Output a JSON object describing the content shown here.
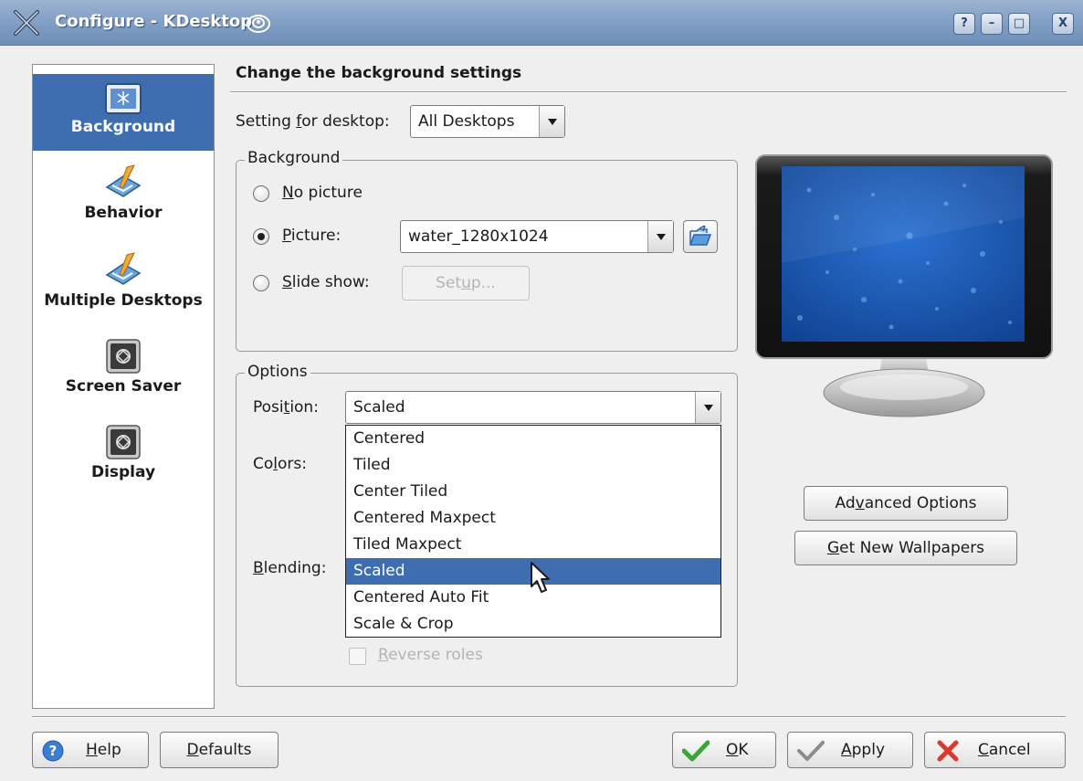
{
  "window": {
    "title": "Configure - KDesktop",
    "controls": {
      "help": "?",
      "minimize": "–",
      "maximize": "□",
      "close": "X"
    }
  },
  "sidebar": {
    "items": [
      {
        "label": "Background",
        "icon": "background-icon",
        "selected": true
      },
      {
        "label": "Behavior",
        "icon": "behavior-icon"
      },
      {
        "label": "Multiple Desktops",
        "icon": "multiple-desktops-icon"
      },
      {
        "label": "Screen Saver",
        "icon": "screen-saver-icon"
      },
      {
        "label": "Display",
        "icon": "display-icon"
      }
    ]
  },
  "main": {
    "heading": "Change the background settings",
    "desktop_setting": {
      "label_pre": "Setting ",
      "label_u": "f",
      "label_post": "or desktop:",
      "value": "All Desktops"
    },
    "background_group": {
      "title": "Background",
      "no_picture": {
        "u": "N",
        "rest": "o picture"
      },
      "picture": {
        "u": "P",
        "rest": "icture:",
        "value": "water_1280x1024",
        "selected": true
      },
      "slide_show": {
        "u": "S",
        "rest": "lide show:"
      },
      "setup_button": {
        "pre": "Set",
        "u": "u",
        "post": "p..."
      }
    },
    "options_group": {
      "title": "Options",
      "position": {
        "pre": "Posi",
        "u": "t",
        "post": "ion:",
        "value": "Scaled"
      },
      "colors": {
        "pre": "Co",
        "u": "l",
        "post": "ors:"
      },
      "blending": {
        "u": "B",
        "rest": "lending:"
      },
      "reverse_roles": {
        "u": "R",
        "rest": "everse roles"
      },
      "position_options": [
        "Centered",
        "Tiled",
        "Center Tiled",
        "Centered Maxpect",
        "Tiled Maxpect",
        "Scaled",
        "Centered Auto Fit",
        "Scale & Crop"
      ],
      "position_selected_index": 5
    },
    "advanced_button": {
      "pre": "Ad",
      "u": "v",
      "post": "anced Options"
    },
    "wallpapers_button": {
      "u": "G",
      "rest": "et New Wallpapers"
    }
  },
  "footer": {
    "help": {
      "u": "H",
      "rest": "elp"
    },
    "defaults": {
      "u": "D",
      "rest": "efaults"
    },
    "ok": {
      "u": "O",
      "rest": "K"
    },
    "apply": {
      "u": "A",
      "rest": "pply"
    },
    "cancel": {
      "u": "C",
      "rest": "ancel"
    }
  },
  "colors": {
    "selection": "#3f6eb0",
    "titlebar": "#84a1c6",
    "wallpaper": "#1e5cb8"
  }
}
